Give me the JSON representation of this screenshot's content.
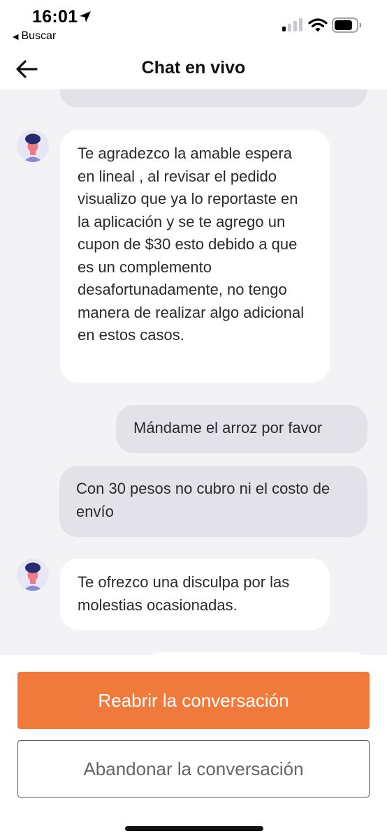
{
  "status_bar": {
    "time": "16:01",
    "back_app_label": "Buscar",
    "icons": [
      "location-arrow-icon",
      "signal-icon",
      "wifi-icon",
      "battery-icon"
    ]
  },
  "nav": {
    "title": "Chat en vivo",
    "back_icon": "arrow-left-icon"
  },
  "messages": [
    {
      "sender": "agent",
      "text": "Te agradezco la amable espera en lineal , al revisar el pedido visualizo que ya lo reportaste en la aplicación y se te agrego un cupon de $30 esto debido a que es un complemento desafortunadamente, no tengo manera de realizar algo adicional en estos casos."
    },
    {
      "sender": "user",
      "text": "Mándame el arroz por favor"
    },
    {
      "sender": "user",
      "text": "Con 30 pesos no cubro ni el costo de envío"
    },
    {
      "sender": "agent",
      "text": "Te ofrezco una disculpa por las molestias ocasionadas."
    }
  ],
  "actions": {
    "reopen_label": "Reabrir la conversación",
    "abandon_label": "Abandonar la conversación"
  },
  "colors": {
    "accent": "#ef7a3b",
    "chat_background": "#f3f3f6",
    "agent_bubble": "#ffffff",
    "user_bubble": "#e2e2e8"
  }
}
